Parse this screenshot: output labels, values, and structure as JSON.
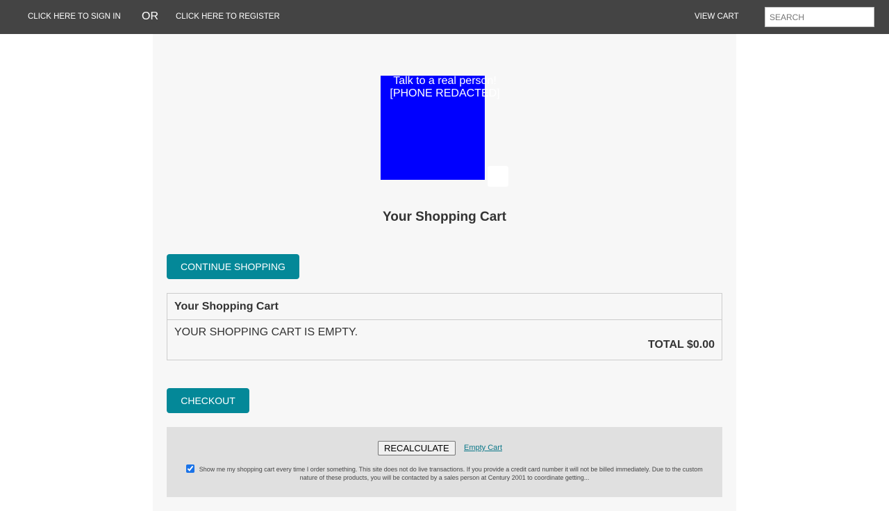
{
  "topbar": {
    "sign_in": "CLICK HERE TO SIGN IN",
    "or": "OR",
    "register": "CLICK HERE TO REGISTER",
    "view_cart": "VIEW CART",
    "search_placeholder": "SEARCH"
  },
  "promo": {
    "line1": "Talk to a real person!",
    "line2": "[PHONE REDACTED]"
  },
  "cart": {
    "page_title": "Your Shopping Cart",
    "continue_label": "CONTINUE SHOPPING",
    "table_header": "Your Shopping Cart",
    "empty_message": "YOUR SHOPPING CART IS EMPTY.",
    "total": "TOTAL $0.00",
    "checkout_label": "CHECKOUT"
  },
  "footer": {
    "recalculate_label": "RECALCULATE",
    "empty_cart_label": "Empty Cart",
    "option_checked": true,
    "option_text": "Show me my shopping cart every time I order something. This site does not do live transactions. If you provide a credit card number it will not be billed immediately. Due to the custom nature of these products, you will be contacted by a sales person at Century 2001 to coordinate getting..."
  },
  "colors": {
    "topbar_bg": "#444444",
    "accent": "#048898",
    "promo_bg": "#0000ff"
  }
}
